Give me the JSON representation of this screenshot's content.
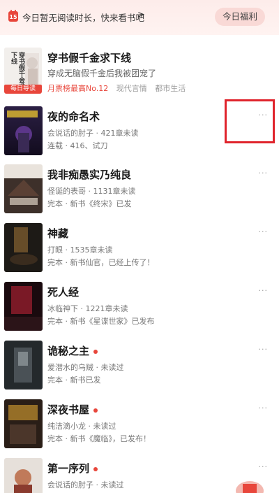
{
  "banner": {
    "calendar_day": "15",
    "text": "今日暂无阅读时长，快来看书吧",
    "chevron": ">",
    "welfare_label": "今日福利"
  },
  "featured": {
    "title": "穿书假千金求下线",
    "subtitle": "穿成无脑假千金后我被团宠了",
    "rank": "月票榜最高No.12",
    "tags": [
      "现代言情",
      "都市生活"
    ],
    "badge": "每日导读",
    "cover_text": "穿书假千金求下线"
  },
  "books": [
    {
      "title": "夜的命名术",
      "author_line": "会说话的肘子 · 421章未读",
      "status_line": "连载 · 416、试刀",
      "dot": false
    },
    {
      "title": "我非痴愚实乃纯良",
      "author_line": "怪诞的表哥 · 1131章未读",
      "status_line": "完本 · 新书《终宋》已发",
      "dot": false
    },
    {
      "title": "神藏",
      "author_line": "打眼 · 1535章未读",
      "status_line": "完本 · 新书仙官，已经上传了！",
      "dot": false
    },
    {
      "title": "死人经",
      "author_line": "冰临神下 · 1221章未读",
      "status_line": "完本 · 新书《星谍世家》已发布",
      "dot": false
    },
    {
      "title": "诡秘之主",
      "author_line": "爱潜水的乌贼 · 未读过",
      "status_line": "完本 · 新书已发",
      "dot": true
    },
    {
      "title": "深夜书屋",
      "author_line": "纯洁滴小龙 · 未读过",
      "status_line": "完本 · 新书《魔临》，已发布！",
      "dot": true
    },
    {
      "title": "第一序列",
      "author_line": "会说话的肘子 · 未读过",
      "status_line": "",
      "dot": true
    }
  ],
  "more_label": "···",
  "colors": {
    "accent": "#e8463b",
    "highlight": "#e0242c"
  },
  "icons": [
    "calendar-icon",
    "chevron-right-icon",
    "more-icon"
  ]
}
